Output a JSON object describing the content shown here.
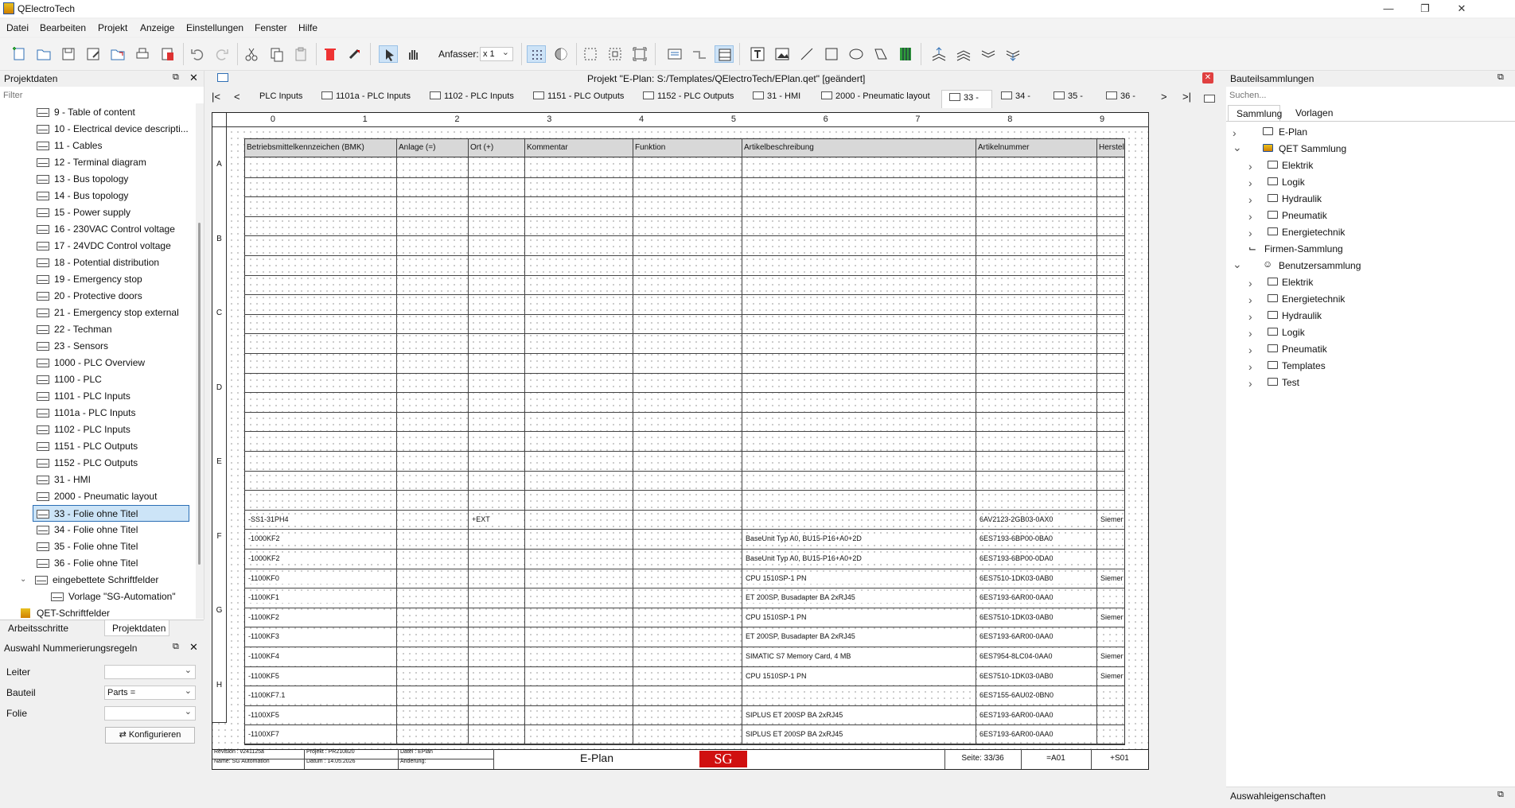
{
  "window": {
    "title": "QElectroTech"
  },
  "menu": [
    "Datei",
    "Bearbeiten",
    "Projekt",
    "Anzeige",
    "Einstellungen",
    "Fenster",
    "Hilfe"
  ],
  "toolbar": {
    "grip_label": "Anfasser:",
    "grip_value": "x 1"
  },
  "left_panel": {
    "title": "Projektdaten",
    "filter_placeholder": "Filter",
    "items": [
      "9 - Table of content",
      "10 - Electrical device descripti...",
      "11 - Cables",
      "12 - Terminal diagram",
      "13 - Bus topology",
      "14 - Bus topology",
      "15 - Power supply",
      "16 - 230VAC Control voltage",
      "17 - 24VDC Control voltage",
      "18 - Potential distribution",
      "19 - Emergency stop",
      "20 - Protective doors",
      "21 - Emergency stop external",
      "22 - Techman",
      "23 - Sensors",
      "1000 - PLC Overview",
      "1100 - PLC",
      "1101 - PLC Inputs",
      "1101a - PLC Inputs",
      "1102 - PLC Inputs",
      "1151 - PLC Outputs",
      "1152 - PLC Outputs",
      "31 - HMI",
      "2000 - Pneumatic layout",
      "33 - Folie ohne Titel",
      "34 - Folie ohne Titel",
      "35 - Folie ohne Titel",
      "36 - Folie ohne Titel"
    ],
    "embedded_group": "eingebettete Schriftfelder",
    "embedded_item": "Vorlage \"SG-Automation\"",
    "qet_group": "QET-Schriftfelder",
    "tabs": [
      "Arbeitsschritte",
      "Projektdaten"
    ]
  },
  "numbering": {
    "title": "Auswahl Nummerierungsregeln",
    "rows": [
      {
        "label": "Leiter",
        "value": ""
      },
      {
        "label": "Bauteil",
        "value": "Parts ="
      },
      {
        "label": "Folie",
        "value": ""
      }
    ],
    "configure_label": "Konfigurieren"
  },
  "document": {
    "title": "Projekt \"E-Plan: S:/Templates/QElectroTech/EPlan.qet\" [geändert]",
    "tabs": [
      "PLC Inputs",
      "1101a - PLC Inputs",
      "1102 - PLC Inputs",
      "1151 - PLC Outputs",
      "1152 - PLC Outputs",
      "31 - HMI",
      "2000 - Pneumatic layout",
      "33 -",
      "34 -",
      "35 -",
      "36 -"
    ]
  },
  "sheet": {
    "columns": [
      "0",
      "1",
      "2",
      "3",
      "4",
      "5",
      "6",
      "7",
      "8",
      "9"
    ],
    "rows": [
      "A",
      "B",
      "C",
      "D",
      "E",
      "F",
      "G",
      "H"
    ],
    "table_headers": [
      "Betriebsmittelkennzeichen (BMK)",
      "Anlage (=)",
      "Ort (+)",
      "Kommentar",
      "Funktion",
      "Artikelbeschreibung",
      "Artikelnummer",
      "Hersteller"
    ],
    "entries": [
      [
        "-SS1-31PH4",
        "",
        "+EXT",
        "",
        "",
        "",
        "6AV2123-2GB03-0AX0",
        "Siemens"
      ],
      [
        "-1000KF2",
        "",
        "",
        "",
        "",
        "BaseUnit Typ A0, BU15-P16+A0+2D",
        "6ES7193-6BP00-0BA0",
        ""
      ],
      [
        "-1000KF2",
        "",
        "",
        "",
        "",
        "BaseUnit Typ A0, BU15-P16+A0+2D",
        "6ES7193-6BP00-0DA0",
        ""
      ],
      [
        "-1100KF0",
        "",
        "",
        "",
        "",
        "CPU 1510SP-1 PN",
        "6ES7510-1DK03-0AB0",
        "Siemens"
      ],
      [
        "-1100KF1",
        "",
        "",
        "",
        "",
        "ET 200SP, Busadapter BA 2xRJ45",
        "6ES7193-6AR00-0AA0",
        ""
      ],
      [
        "-1100KF2",
        "",
        "",
        "",
        "",
        "CPU 1510SP-1 PN",
        "6ES7510-1DK03-0AB0",
        "Siemens"
      ],
      [
        "-1100KF3",
        "",
        "",
        "",
        "",
        "ET 200SP, Busadapter BA 2xRJ45",
        "6ES7193-6AR00-0AA0",
        ""
      ],
      [
        "-1100KF4",
        "",
        "",
        "",
        "",
        "SIMATIC S7 Memory Card, 4 MB",
        "6ES7954-8LC04-0AA0",
        "Siemens"
      ],
      [
        "-1100KF5",
        "",
        "",
        "",
        "",
        "CPU 1510SP-1 PN",
        "6ES7510-1DK03-0AB0",
        "Siemens"
      ],
      [
        "-1100KF7.1",
        "",
        "",
        "",
        "",
        "",
        "6ES7155-6AU02-0BN0",
        ""
      ],
      [
        "-1100XF5",
        "",
        "",
        "",
        "",
        "SIPLUS ET 200SP BA 2xRJ45",
        "6ES7193-6AR00-0AA0",
        ""
      ],
      [
        "-1100XF7",
        "",
        "",
        "",
        "",
        "SIPLUS ET 200SP BA 2xRJ45",
        "6ES7193-6AR00-0AA0",
        ""
      ]
    ],
    "titleblock": {
      "revision": "Revision : v241125a",
      "name": "Name: SG Automation",
      "projekt": "Projekt : PR210820",
      "datum": "Datum : 14.05.2026",
      "datei": "Datei : EPlan",
      "aenderung": "Änderung:",
      "title": "E-Plan",
      "logo": "SG",
      "page": "Seite: 33/36",
      "anlage": "=A01",
      "ort": "+S01"
    }
  },
  "right_panel": {
    "title": "Bauteilsammlungen",
    "search_placeholder": "Suchen...",
    "tabs": [
      "Sammlung",
      "Vorlagen"
    ],
    "tree": [
      {
        "label": "E-Plan",
        "level": 0,
        "chev": ">"
      },
      {
        "label": "QET Sammlung",
        "level": 0,
        "chev": "v"
      },
      {
        "label": "Elektrik",
        "level": 1,
        "chev": ">"
      },
      {
        "label": "Logik",
        "level": 1,
        "chev": ">"
      },
      {
        "label": "Hydraulik",
        "level": 1,
        "chev": ">"
      },
      {
        "label": "Pneumatik",
        "level": 1,
        "chev": ">"
      },
      {
        "label": "Energietechnik",
        "level": 1,
        "chev": ">"
      },
      {
        "label": "Firmen-Sammlung",
        "level": 0,
        "chev": ""
      },
      {
        "label": "Benutzersammlung",
        "level": 0,
        "chev": "v"
      },
      {
        "label": "Elektrik",
        "level": 1,
        "chev": ">"
      },
      {
        "label": "Energietechnik",
        "level": 1,
        "chev": ">"
      },
      {
        "label": "Hydraulik",
        "level": 1,
        "chev": ">"
      },
      {
        "label": "Logik",
        "level": 1,
        "chev": ">"
      },
      {
        "label": "Pneumatik",
        "level": 1,
        "chev": ">"
      },
      {
        "label": "Templates",
        "level": 1,
        "chev": ">"
      },
      {
        "label": "Test",
        "level": 1,
        "chev": ">"
      }
    ],
    "bottom_title": "Auswahleigenschaften"
  }
}
